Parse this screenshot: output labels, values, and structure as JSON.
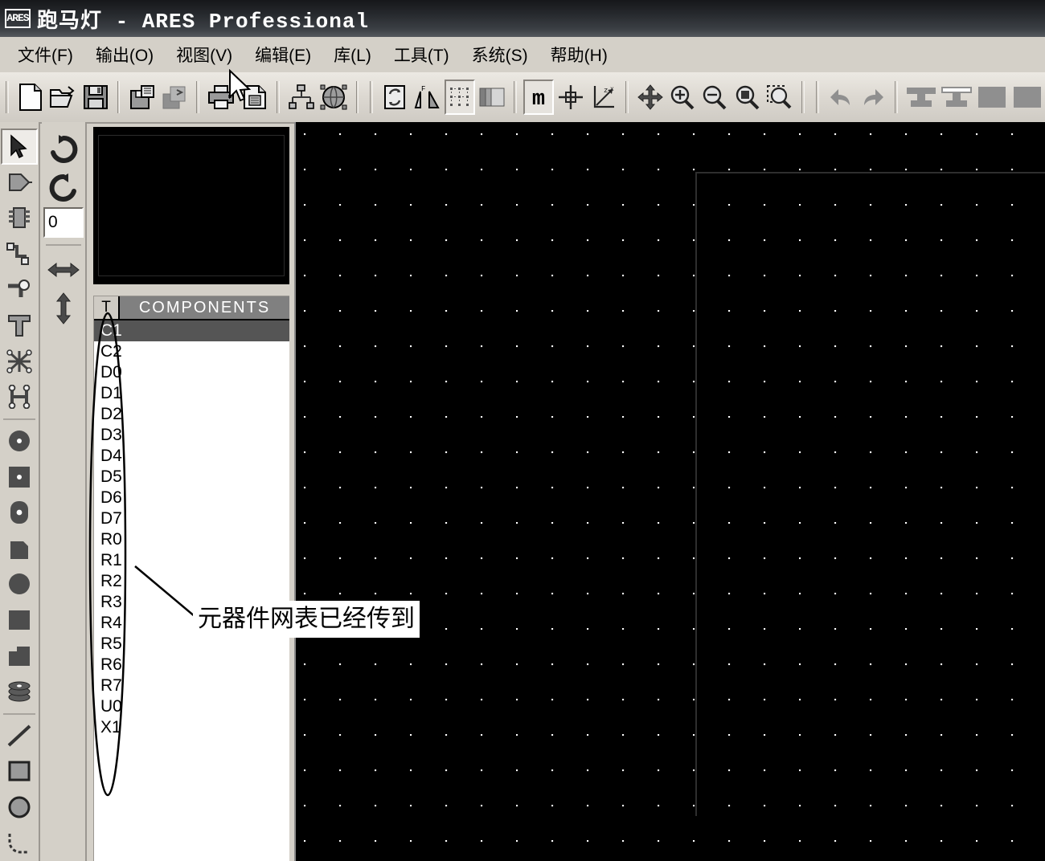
{
  "window": {
    "app_icon": "ares-logo-icon",
    "logo_text": "ARES",
    "title": "跑马灯 - ARES Professional"
  },
  "menubar": {
    "items": [
      {
        "label": "文件(F)",
        "name": "menu-file"
      },
      {
        "label": "输出(O)",
        "name": "menu-output"
      },
      {
        "label": "视图(V)",
        "name": "menu-view"
      },
      {
        "label": "编辑(E)",
        "name": "menu-edit"
      },
      {
        "label": "库(L)",
        "name": "menu-library"
      },
      {
        "label": "工具(T)",
        "name": "menu-tools"
      },
      {
        "label": "系统(S)",
        "name": "menu-system"
      },
      {
        "label": "帮助(H)",
        "name": "menu-help"
      }
    ]
  },
  "toolbar": {
    "buttons": [
      {
        "icon": "new-file-icon",
        "label": "New"
      },
      {
        "icon": "open-folder-icon",
        "label": "Open"
      },
      {
        "icon": "save-disk-icon",
        "label": "Save"
      },
      {
        "icon": "import-icon",
        "label": "Import"
      },
      {
        "icon": "export-icon",
        "label": "Export"
      },
      {
        "icon": "print-icon",
        "label": "Print"
      },
      {
        "icon": "print-area-icon",
        "label": "Print Area"
      },
      {
        "icon": "netlist-icon",
        "label": "Netlist"
      },
      {
        "icon": "3d-view-icon",
        "label": "3D Visualisation"
      },
      {
        "icon": "refresh-netlist-icon",
        "label": "Refresh Netlist"
      },
      {
        "icon": "design-rule-icon",
        "label": "Design Rule Manager"
      },
      {
        "icon": "grid-toggle-icon",
        "label": "Toggle Grid",
        "pressed": true
      },
      {
        "icon": "layers-icon",
        "label": "Layer Selector"
      },
      {
        "icon": "metric-icon",
        "label": "Metric / Imperial",
        "pressed": true
      },
      {
        "icon": "origin-icon",
        "label": "Set Origin"
      },
      {
        "icon": "false-origin-icon",
        "label": "False Origin"
      },
      {
        "icon": "pan-icon",
        "label": "Pan"
      },
      {
        "icon": "zoom-in-icon",
        "label": "Zoom In"
      },
      {
        "icon": "zoom-out-icon",
        "label": "Zoom Out"
      },
      {
        "icon": "zoom-all-icon",
        "label": "Zoom All"
      },
      {
        "icon": "zoom-area-icon",
        "label": "Zoom Area"
      },
      {
        "icon": "undo-icon",
        "label": "Undo"
      },
      {
        "icon": "redo-icon",
        "label": "Redo"
      },
      {
        "icon": "block-copy-icon",
        "label": "Block Copy"
      },
      {
        "icon": "block-move-icon",
        "label": "Block Move"
      },
      {
        "icon": "block-rotate-icon",
        "label": "Block Rotate"
      },
      {
        "icon": "block-delete-icon",
        "label": "Block Delete"
      }
    ]
  },
  "left_toolbar": {
    "buttons": [
      {
        "icon": "selection-arrow-icon",
        "label": "Selection Mode",
        "active": true
      },
      {
        "icon": "component-mode-icon",
        "label": "Component Mode"
      },
      {
        "icon": "package-mode-icon",
        "label": "Package Mode"
      },
      {
        "icon": "track-mode-icon",
        "label": "Track Mode"
      },
      {
        "icon": "via-mode-icon",
        "label": "Via Mode"
      },
      {
        "icon": "zone-mode-icon",
        "label": "Zone Mode"
      },
      {
        "icon": "ratsnest-mode-icon",
        "label": "Ratsnest Mode"
      },
      {
        "icon": "connectivity-icon",
        "label": "Connectivity Highlight"
      },
      {
        "icon": "round-pad-icon",
        "label": "Round Through-hole Pad"
      },
      {
        "icon": "square-pad-icon",
        "label": "Square Through-hole Pad"
      },
      {
        "icon": "dil-pad-icon",
        "label": "DIL Pad"
      },
      {
        "icon": "smt-pad-icon",
        "label": "SMT Pad"
      },
      {
        "icon": "circular-smt-pad-icon",
        "label": "Circular SMT Pad"
      },
      {
        "icon": "rect-smt-pad-icon",
        "label": "Rectangular SMT Pad"
      },
      {
        "icon": "polygonal-pad-icon",
        "label": "Polygonal Pad"
      },
      {
        "icon": "pad-stack-icon",
        "label": "Pad Stack"
      },
      {
        "icon": "line-2d-icon",
        "label": "2D Graphics Line"
      },
      {
        "icon": "box-2d-icon",
        "label": "2D Graphics Box"
      },
      {
        "icon": "circle-2d-icon",
        "label": "2D Graphics Circle"
      },
      {
        "icon": "arc-2d-icon",
        "label": "2D Graphics Arc"
      }
    ]
  },
  "rotate_toolbar": {
    "buttons": [
      {
        "icon": "rotate-cw-icon",
        "label": "Rotate Clockwise"
      },
      {
        "icon": "rotate-ccw-icon",
        "label": "Rotate Anticlockwise"
      },
      {
        "icon": "mirror-x-icon",
        "label": "Mirror Horizontally"
      },
      {
        "icon": "mirror-y-icon",
        "label": "Mirror Vertically"
      }
    ],
    "angle_value": "0",
    "angle_placeholder": "0"
  },
  "overview": {
    "name": "overview-preview-panel"
  },
  "components_panel": {
    "type_column_header": "T",
    "name_column_header": "COMPONENTS",
    "selected": "C1",
    "items": [
      "C1",
      "C2",
      "D0",
      "D1",
      "D2",
      "D3",
      "D4",
      "D5",
      "D6",
      "D7",
      "R0",
      "R1",
      "R2",
      "R3",
      "R4",
      "R5",
      "R6",
      "R7",
      "U0",
      "X1"
    ]
  },
  "annotation": {
    "text": "元器件网表已经传到",
    "marker": "ellipse-highlight",
    "leader": "leader-line"
  },
  "canvas": {
    "name": "pcb-editor-canvas",
    "grid": "dot-grid",
    "board_outline": "board-edge-rectangle"
  },
  "colors": {
    "titlebar_dark": "#1a1c1f",
    "chrome": "#d4d0c8",
    "canvas_bg": "#000000",
    "grid_dot": "#ffffff",
    "selection_row": "#555555",
    "header_gray": "#808080"
  }
}
